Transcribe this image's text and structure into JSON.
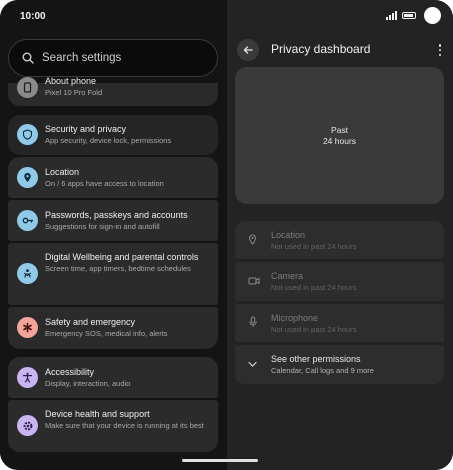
{
  "status_bar": {
    "time": "10:00"
  },
  "search": {
    "placeholder": "Search settings"
  },
  "settings_list": {
    "about": {
      "title": "About phone",
      "subtitle": "Pixel 10 Pro Fold"
    },
    "items": [
      {
        "title": "Security and privacy",
        "subtitle": "App security, device lock, permissions",
        "icon": "shield-icon",
        "icon_color": "#8fcbe9"
      },
      {
        "title": "Location",
        "subtitle": "On / 6 apps have access to location",
        "icon": "location-pin-icon",
        "icon_color": "#8fcbe9"
      },
      {
        "title": "Passwords, passkeys and accounts",
        "subtitle": "Suggestions for sign-in and autofill",
        "icon": "key-icon",
        "icon_color": "#8fcbe9"
      },
      {
        "title": "Digital Wellbeing and parental controls",
        "subtitle": "Screen time, app timers, bedtime schedules",
        "icon": "wellbeing-icon",
        "icon_color": "#8fcbe9"
      },
      {
        "title": "Safety and emergency",
        "subtitle": "Emergency SOS, medical info, alerts",
        "icon": "asterisk-icon",
        "icon_color": "#f2a59a"
      },
      {
        "title": "Accessibility",
        "subtitle": "Display, interaction, audio",
        "icon": "accessibility-icon",
        "icon_color": "#c8b6f2"
      },
      {
        "title": "Device health and support",
        "subtitle": "Make sure that your device is running at its best",
        "icon": "gear-icon",
        "icon_color": "#c8b6f2"
      }
    ]
  },
  "privacy_dashboard": {
    "title": "Privacy dashboard",
    "chart_label_line1": "Past",
    "chart_label_line2": "24 hours",
    "permissions": [
      {
        "title": "Location",
        "subtitle": "Not used in past 24 hours",
        "icon": "location-outline-icon"
      },
      {
        "title": "Camera",
        "subtitle": "Not used in past 24 hours",
        "icon": "camera-icon"
      },
      {
        "title": "Microphone",
        "subtitle": "Not used in past 24 hours",
        "icon": "microphone-icon"
      }
    ],
    "see_other": {
      "title": "See other permissions",
      "subtitle": "Calendar, Call logs and 9 more",
      "icon": "chevron-down-icon"
    }
  },
  "colors": {
    "background": "#141414",
    "card": "#2b2b2b",
    "right_pane": "#232323",
    "accent_blue": "#8fcbe9",
    "accent_red": "#f2a59a",
    "accent_purple": "#c8b6f2"
  }
}
